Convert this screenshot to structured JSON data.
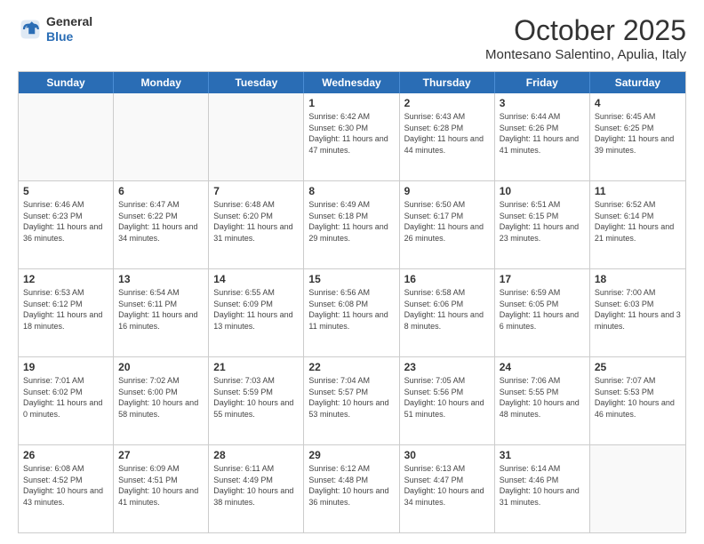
{
  "logo": {
    "general": "General",
    "blue": "Blue"
  },
  "header": {
    "month": "October 2025",
    "location": "Montesano Salentino, Apulia, Italy"
  },
  "weekdays": [
    "Sunday",
    "Monday",
    "Tuesday",
    "Wednesday",
    "Thursday",
    "Friday",
    "Saturday"
  ],
  "weeks": [
    [
      {
        "day": "",
        "info": ""
      },
      {
        "day": "",
        "info": ""
      },
      {
        "day": "",
        "info": ""
      },
      {
        "day": "1",
        "info": "Sunrise: 6:42 AM\nSunset: 6:30 PM\nDaylight: 11 hours and 47 minutes."
      },
      {
        "day": "2",
        "info": "Sunrise: 6:43 AM\nSunset: 6:28 PM\nDaylight: 11 hours and 44 minutes."
      },
      {
        "day": "3",
        "info": "Sunrise: 6:44 AM\nSunset: 6:26 PM\nDaylight: 11 hours and 41 minutes."
      },
      {
        "day": "4",
        "info": "Sunrise: 6:45 AM\nSunset: 6:25 PM\nDaylight: 11 hours and 39 minutes."
      }
    ],
    [
      {
        "day": "5",
        "info": "Sunrise: 6:46 AM\nSunset: 6:23 PM\nDaylight: 11 hours and 36 minutes."
      },
      {
        "day": "6",
        "info": "Sunrise: 6:47 AM\nSunset: 6:22 PM\nDaylight: 11 hours and 34 minutes."
      },
      {
        "day": "7",
        "info": "Sunrise: 6:48 AM\nSunset: 6:20 PM\nDaylight: 11 hours and 31 minutes."
      },
      {
        "day": "8",
        "info": "Sunrise: 6:49 AM\nSunset: 6:18 PM\nDaylight: 11 hours and 29 minutes."
      },
      {
        "day": "9",
        "info": "Sunrise: 6:50 AM\nSunset: 6:17 PM\nDaylight: 11 hours and 26 minutes."
      },
      {
        "day": "10",
        "info": "Sunrise: 6:51 AM\nSunset: 6:15 PM\nDaylight: 11 hours and 23 minutes."
      },
      {
        "day": "11",
        "info": "Sunrise: 6:52 AM\nSunset: 6:14 PM\nDaylight: 11 hours and 21 minutes."
      }
    ],
    [
      {
        "day": "12",
        "info": "Sunrise: 6:53 AM\nSunset: 6:12 PM\nDaylight: 11 hours and 18 minutes."
      },
      {
        "day": "13",
        "info": "Sunrise: 6:54 AM\nSunset: 6:11 PM\nDaylight: 11 hours and 16 minutes."
      },
      {
        "day": "14",
        "info": "Sunrise: 6:55 AM\nSunset: 6:09 PM\nDaylight: 11 hours and 13 minutes."
      },
      {
        "day": "15",
        "info": "Sunrise: 6:56 AM\nSunset: 6:08 PM\nDaylight: 11 hours and 11 minutes."
      },
      {
        "day": "16",
        "info": "Sunrise: 6:58 AM\nSunset: 6:06 PM\nDaylight: 11 hours and 8 minutes."
      },
      {
        "day": "17",
        "info": "Sunrise: 6:59 AM\nSunset: 6:05 PM\nDaylight: 11 hours and 6 minutes."
      },
      {
        "day": "18",
        "info": "Sunrise: 7:00 AM\nSunset: 6:03 PM\nDaylight: 11 hours and 3 minutes."
      }
    ],
    [
      {
        "day": "19",
        "info": "Sunrise: 7:01 AM\nSunset: 6:02 PM\nDaylight: 11 hours and 0 minutes."
      },
      {
        "day": "20",
        "info": "Sunrise: 7:02 AM\nSunset: 6:00 PM\nDaylight: 10 hours and 58 minutes."
      },
      {
        "day": "21",
        "info": "Sunrise: 7:03 AM\nSunset: 5:59 PM\nDaylight: 10 hours and 55 minutes."
      },
      {
        "day": "22",
        "info": "Sunrise: 7:04 AM\nSunset: 5:57 PM\nDaylight: 10 hours and 53 minutes."
      },
      {
        "day": "23",
        "info": "Sunrise: 7:05 AM\nSunset: 5:56 PM\nDaylight: 10 hours and 51 minutes."
      },
      {
        "day": "24",
        "info": "Sunrise: 7:06 AM\nSunset: 5:55 PM\nDaylight: 10 hours and 48 minutes."
      },
      {
        "day": "25",
        "info": "Sunrise: 7:07 AM\nSunset: 5:53 PM\nDaylight: 10 hours and 46 minutes."
      }
    ],
    [
      {
        "day": "26",
        "info": "Sunrise: 6:08 AM\nSunset: 4:52 PM\nDaylight: 10 hours and 43 minutes."
      },
      {
        "day": "27",
        "info": "Sunrise: 6:09 AM\nSunset: 4:51 PM\nDaylight: 10 hours and 41 minutes."
      },
      {
        "day": "28",
        "info": "Sunrise: 6:11 AM\nSunset: 4:49 PM\nDaylight: 10 hours and 38 minutes."
      },
      {
        "day": "29",
        "info": "Sunrise: 6:12 AM\nSunset: 4:48 PM\nDaylight: 10 hours and 36 minutes."
      },
      {
        "day": "30",
        "info": "Sunrise: 6:13 AM\nSunset: 4:47 PM\nDaylight: 10 hours and 34 minutes."
      },
      {
        "day": "31",
        "info": "Sunrise: 6:14 AM\nSunset: 4:46 PM\nDaylight: 10 hours and 31 minutes."
      },
      {
        "day": "",
        "info": ""
      }
    ]
  ]
}
